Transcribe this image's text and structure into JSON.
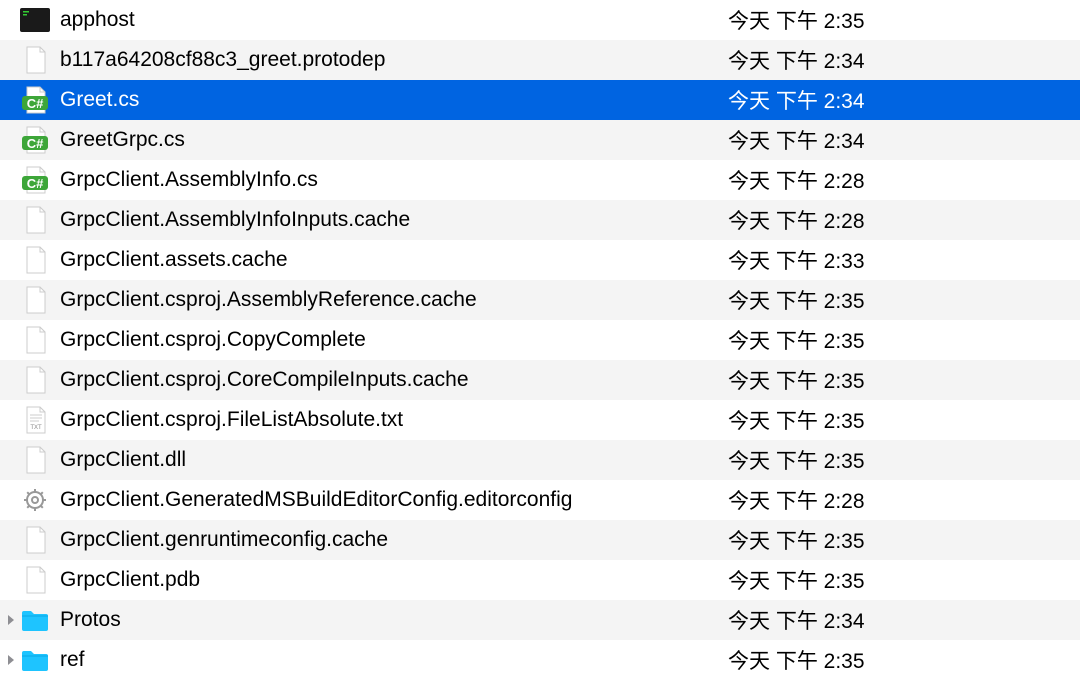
{
  "files": [
    {
      "name": "apphost",
      "date": "今天 下午 2:35",
      "icon": "exec",
      "selected": false,
      "folder": false
    },
    {
      "name": "b117a64208cf88c3_greet.protodep",
      "date": "今天 下午 2:34",
      "icon": "blank",
      "selected": false,
      "folder": false
    },
    {
      "name": "Greet.cs",
      "date": "今天 下午 2:34",
      "icon": "csharp",
      "selected": true,
      "folder": false
    },
    {
      "name": "GreetGrpc.cs",
      "date": "今天 下午 2:34",
      "icon": "csharp",
      "selected": false,
      "folder": false
    },
    {
      "name": "GrpcClient.AssemblyInfo.cs",
      "date": "今天 下午 2:28",
      "icon": "csharp",
      "selected": false,
      "folder": false
    },
    {
      "name": "GrpcClient.AssemblyInfoInputs.cache",
      "date": "今天 下午 2:28",
      "icon": "blank",
      "selected": false,
      "folder": false
    },
    {
      "name": "GrpcClient.assets.cache",
      "date": "今天 下午 2:33",
      "icon": "blank",
      "selected": false,
      "folder": false
    },
    {
      "name": "GrpcClient.csproj.AssemblyReference.cache",
      "date": "今天 下午 2:35",
      "icon": "blank",
      "selected": false,
      "folder": false
    },
    {
      "name": "GrpcClient.csproj.CopyComplete",
      "date": "今天 下午 2:35",
      "icon": "blank",
      "selected": false,
      "folder": false
    },
    {
      "name": "GrpcClient.csproj.CoreCompileInputs.cache",
      "date": "今天 下午 2:35",
      "icon": "blank",
      "selected": false,
      "folder": false
    },
    {
      "name": "GrpcClient.csproj.FileListAbsolute.txt",
      "date": "今天 下午 2:35",
      "icon": "txt",
      "selected": false,
      "folder": false
    },
    {
      "name": "GrpcClient.dll",
      "date": "今天 下午 2:35",
      "icon": "blank",
      "selected": false,
      "folder": false
    },
    {
      "name": "GrpcClient.GeneratedMSBuildEditorConfig.editorconfig",
      "date": "今天 下午 2:28",
      "icon": "gear",
      "selected": false,
      "folder": false
    },
    {
      "name": "GrpcClient.genruntimeconfig.cache",
      "date": "今天 下午 2:35",
      "icon": "blank",
      "selected": false,
      "folder": false
    },
    {
      "name": "GrpcClient.pdb",
      "date": "今天 下午 2:35",
      "icon": "blank",
      "selected": false,
      "folder": false
    },
    {
      "name": "Protos",
      "date": "今天 下午 2:34",
      "icon": "folder",
      "selected": false,
      "folder": true
    },
    {
      "name": "ref",
      "date": "今天 下午 2:35",
      "icon": "folder",
      "selected": false,
      "folder": true
    }
  ]
}
